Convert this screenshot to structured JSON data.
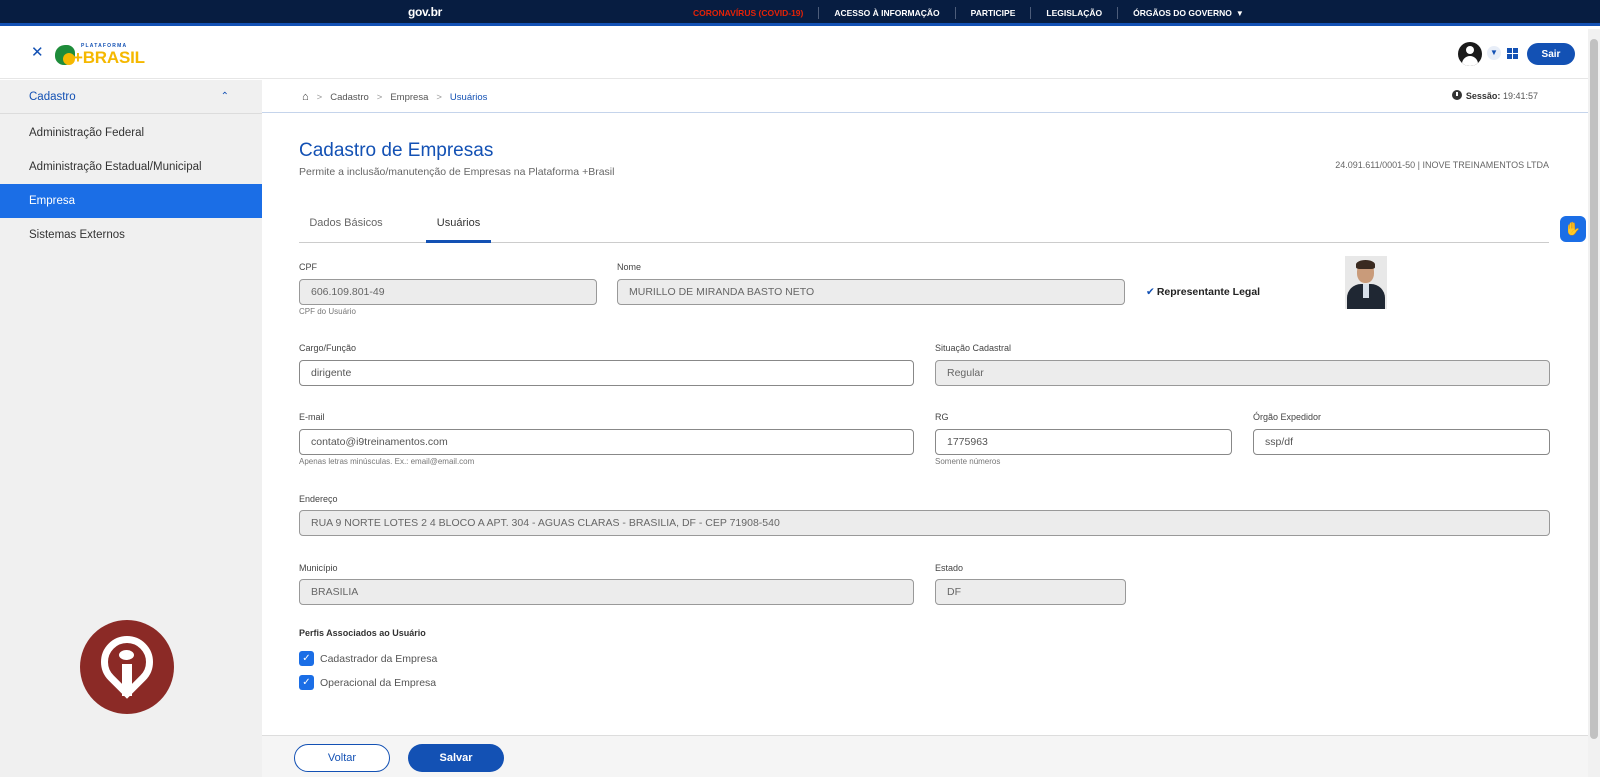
{
  "govbar": {
    "brand": "gov.br",
    "links": [
      "CORONAVÍRUS (COVID-19)",
      "ACESSO À INFORMAÇÃO",
      "PARTICIPE",
      "LEGISLAÇÃO",
      "ÓRGÃOS DO GOVERNO"
    ]
  },
  "header": {
    "logo_small": "PLATAFORMA",
    "logo_big": "+BRASIL",
    "logout_label": "Sair"
  },
  "sidebar": {
    "section": "Cadastro",
    "items": [
      "Administração Federal",
      "Administração Estadual/Municipal",
      "Empresa",
      "Sistemas Externos"
    ],
    "active_index": 2
  },
  "breadcrumb": [
    "Cadastro",
    "Empresa",
    "Usuários"
  ],
  "session": {
    "label": "Sessão:",
    "time": "19:41:57"
  },
  "page": {
    "title": "Cadastro de Empresas",
    "subtitle": "Permite a inclusão/manutenção de Empresas na Plataforma +Brasil",
    "company": "24.091.611/0001-50 | INOVE TREINAMENTOS LTDA"
  },
  "tabs": [
    "Dados Básicos",
    "Usuários"
  ],
  "form": {
    "cpf_label": "CPF",
    "cpf_value": "606.109.801-49",
    "cpf_hint": "CPF do Usuário",
    "nome_label": "Nome",
    "nome_value": "MURILLO DE MIRANDA BASTO NETO",
    "representante": "Representante Legal",
    "cargo_label": "Cargo/Função",
    "cargo_value": "dirigente",
    "situacao_label": "Situação Cadastral",
    "situacao_value": "Regular",
    "email_label": "E-mail",
    "email_value": "contato@i9treinamentos.com",
    "email_hint": "Apenas letras minúsculas. Ex.: email@email.com",
    "rg_label": "RG",
    "rg_value": "1775963",
    "rg_hint": "Somente números",
    "orgao_label": "Órgão Expedidor",
    "orgao_value": "ssp/df",
    "endereco_label": "Endereço",
    "endereco_value": "RUA 9 NORTE LOTES 2 4 BLOCO A APT. 304 - AGUAS CLARAS - BRASILIA, DF - CEP 71908-540",
    "municipio_label": "Município",
    "municipio_value": "BRASILIA",
    "estado_label": "Estado",
    "estado_value": "DF"
  },
  "perfis": {
    "title": "Perfis Associados ao Usuário",
    "items": [
      {
        "label": "Cadastrador da Empresa",
        "checked": true
      },
      {
        "label": "Operacional da Empresa",
        "checked": true
      }
    ]
  },
  "footer": {
    "back_label": "Voltar",
    "save_label": "Salvar"
  },
  "colors": {
    "primary": "#1351b4",
    "govbar": "#071d41",
    "alert": "#e52207",
    "active": "#1b6ee6",
    "logo_accent": "#8b2a26"
  }
}
